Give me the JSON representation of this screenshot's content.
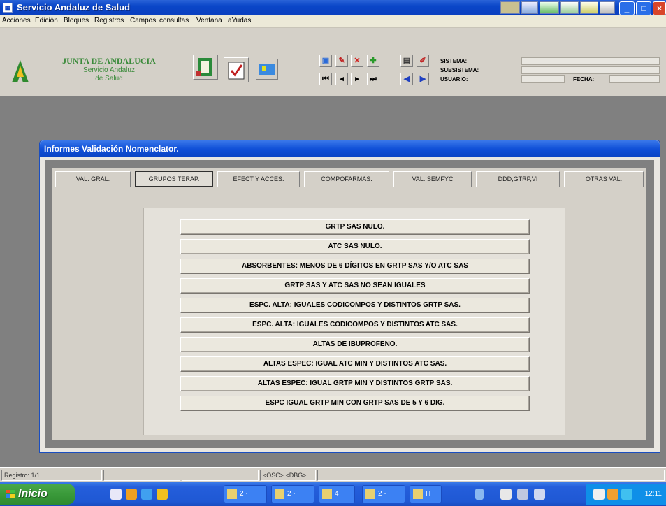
{
  "window": {
    "title": "Servicio Andaluz de Salud"
  },
  "menu": [
    "Acciones",
    "Edición",
    "Bloques",
    "Registros",
    "Campos",
    "consultas",
    "Ventana",
    "aYudas"
  ],
  "logo": {
    "title": "JUNTA DE ANDALUCIA",
    "line1": "Servicio Andaluz",
    "line2": "de Salud"
  },
  "info": {
    "sistema_label": "SISTEMA:",
    "subsistema_label": "SUBSISTEMA:",
    "usuario_label": "USUARIO:",
    "fecha_label": "FECHA:"
  },
  "dialog": {
    "title": "Informes Validación Nomenclator.",
    "tabs": [
      "VAL. GRAL.",
      "GRUPOS TERAP.",
      "EFECT Y ACCES.",
      "COMPOFARMAS.",
      "VAL. SEMFYC",
      "DDD,GTRP,VI",
      "OTRAS VAL."
    ],
    "active_tab": "GRUPOS TERAP.",
    "buttons": [
      "GRTP SAS NULO.",
      "ATC SAS NULO.",
      "ABSORBENTES: MENOS DE 6 DÍGITOS EN GRTP SAS Y/O ATC SAS",
      "GRTP SAS Y ATC SAS NO SEAN IGUALES",
      "ESPC. ALTA: IGUALES CODICOMPOS Y DISTINTOS GRTP SAS.",
      "ESPC. ALTA: IGUALES CODICOMPOS Y DISTINTOS ATC SAS.",
      "ALTAS DE IBUPROFENO.",
      "ALTAS ESPEC: IGUAL ATC MIN Y DISTINTOS ATC SAS.",
      "ALTAS ESPEC: IGUAL GRTP MIN Y DISTINTOS GRTP SAS.",
      "ESPC IGUAL GRTP MIN CON GRTP SAS DE 5 Y 6 DIG."
    ]
  },
  "status": {
    "record": "Registro: 1/1",
    "osc_dbg": "<OSC> <DBG>"
  },
  "taskbar": {
    "start": "Inicio",
    "tasks": [
      "2 ·",
      "2 ·",
      "4",
      "2 ·",
      "H"
    ],
    "clock": "12:11"
  },
  "colors": {
    "titlebar": "#0a46c8",
    "accent_green": "#3a8a3a",
    "workspace": "#808080"
  }
}
